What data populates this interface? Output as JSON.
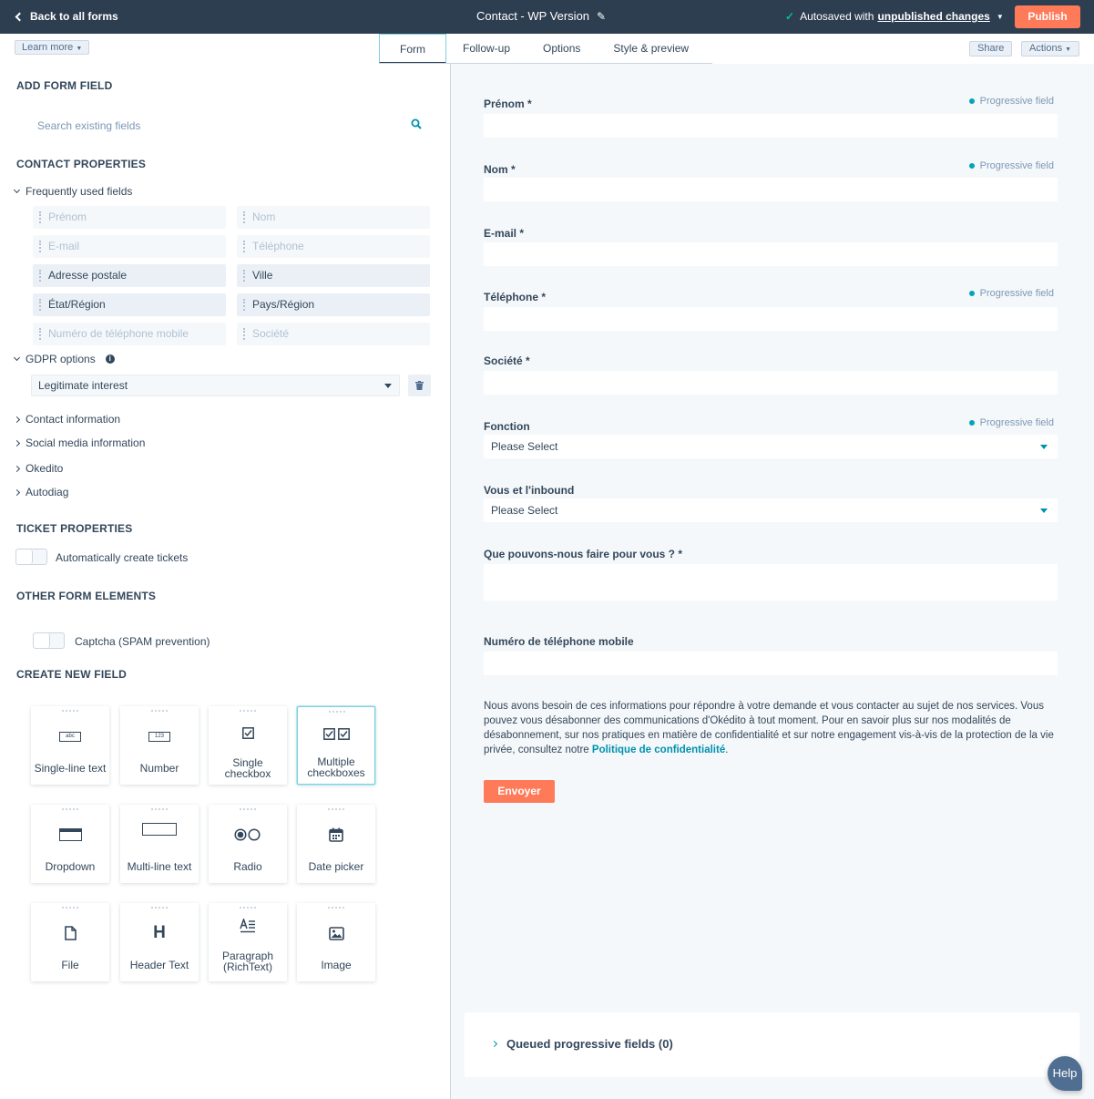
{
  "topbar": {
    "back_label": "Back to all forms",
    "form_title": "Contact - WP Version",
    "autosave_prefix": "Autosaved with",
    "autosave_link": "unpublished changes",
    "publish_label": "Publish"
  },
  "toolbar": {
    "learn_more": "Learn more",
    "tabs": [
      "Form",
      "Follow-up",
      "Options",
      "Style & preview"
    ],
    "share": "Share",
    "actions": "Actions"
  },
  "left": {
    "add_form_field": "ADD FORM FIELD",
    "search_placeholder": "Search existing fields",
    "contact_properties": "CONTACT PROPERTIES",
    "frequently_used": "Frequently used fields",
    "fields": [
      "Prénom",
      "Nom",
      "E-mail",
      "Téléphone",
      "Adresse postale",
      "Ville",
      "État/Région",
      "Pays/Région",
      "Numéro de téléphone mobile",
      "Société"
    ],
    "gdpr_options": "GDPR options",
    "gdpr_value": "Legitimate interest",
    "groups": [
      "Contact information",
      "Social media information",
      "Okedito",
      "Autodiag"
    ],
    "ticket_properties": "TICKET PROPERTIES",
    "auto_tickets": "Automatically create tickets",
    "other_elements": "OTHER FORM ELEMENTS",
    "captcha": "Captcha (SPAM prevention)",
    "create_new": "CREATE NEW FIELD",
    "cards": [
      "Single-line text",
      "Number",
      "Single checkbox",
      "Multiple checkboxes",
      "Dropdown",
      "Multi-line text",
      "Radio",
      "Date picker",
      "File",
      "Header Text",
      "Paragraph (RichText)",
      "Image"
    ],
    "card_abc": "abc",
    "card_123": "123",
    "card_header_glyph": "H"
  },
  "preview": {
    "progressive": "Progressive field",
    "labels": [
      "Prénom *",
      "Nom *",
      "E-mail *",
      "Téléphone *",
      "Société *",
      "Fonction",
      "Vous et l'inbound",
      "Que pouvons-nous faire pour vous ? *",
      "Numéro de téléphone mobile"
    ],
    "please_select": "Please Select",
    "legal_text": "Nous avons besoin de ces informations pour répondre à votre demande et vous contacter au sujet de nos services. Vous pouvez vous désabonner des communications d'Okédito à tout moment. Pour en savoir plus sur nos modalités de désabonnement, sur nos pratiques en matière de confidentialité et sur notre engagement vis-à-vis de la protection de la vie privée, consultez notre",
    "legal_link": "Politique de confidentialité",
    "legal_end": ".",
    "submit": "Envoyer",
    "queued": "Queued progressive fields (0)",
    "help": "Help"
  }
}
